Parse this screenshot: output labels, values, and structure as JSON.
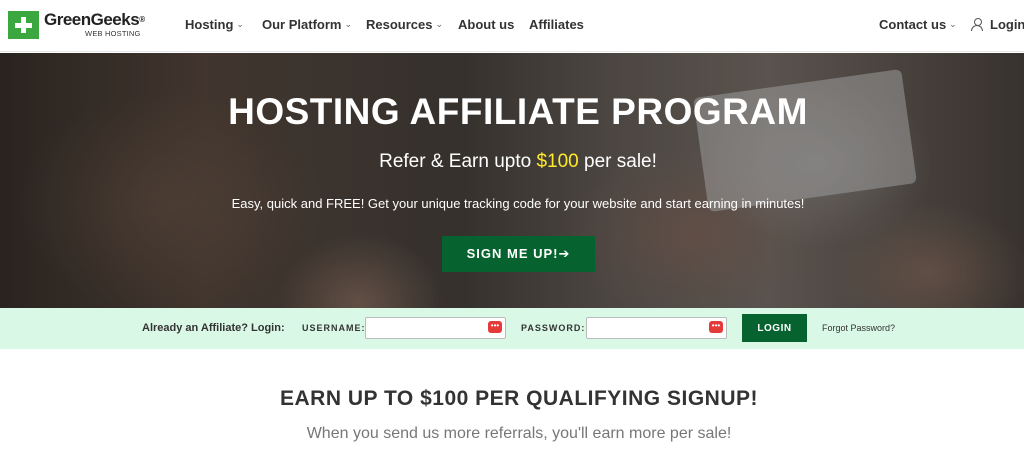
{
  "header": {
    "logo_name": "GreenGeeks",
    "logo_reg": "®",
    "logo_sub": "WEB HOSTING",
    "nav": [
      {
        "label": "Hosting",
        "dropdown": true
      },
      {
        "label": "Our Platform",
        "dropdown": true
      },
      {
        "label": "Resources",
        "dropdown": true
      },
      {
        "label": "About us",
        "dropdown": false
      },
      {
        "label": "Affiliates",
        "dropdown": false
      }
    ],
    "contact_label": "Contact us",
    "login_label": "Login",
    "caret": "⌄"
  },
  "hero": {
    "title": "HOSTING AFFILIATE PROGRAM",
    "subtitle_prefix": "Refer & Earn upto ",
    "subtitle_amount": "$100",
    "subtitle_suffix": " per sale!",
    "description": "Easy, quick and FREE! Get your unique tracking code for your website and start earning in minutes!",
    "cta_label": "SIGN ME UP!➔"
  },
  "login_bar": {
    "label": "Already an Affiliate? Login:",
    "username_label": "USERNAME:",
    "username_value": "",
    "password_label": "PASSWORD:",
    "password_value": "",
    "field_icon": "•••",
    "login_button": "LOGIN",
    "forgot_link": "Forgot Password?"
  },
  "earn": {
    "title": "EARN UP TO $100 PER QUALIFYING SIGNUP!",
    "subtitle": "When you send us more referrals, you'll earn more per sale!"
  },
  "colors": {
    "brand_green": "#3aa83f",
    "button_green": "#06632f",
    "highlight_yellow": "#ffea2a",
    "login_bar_bg": "#d9f9e6"
  }
}
